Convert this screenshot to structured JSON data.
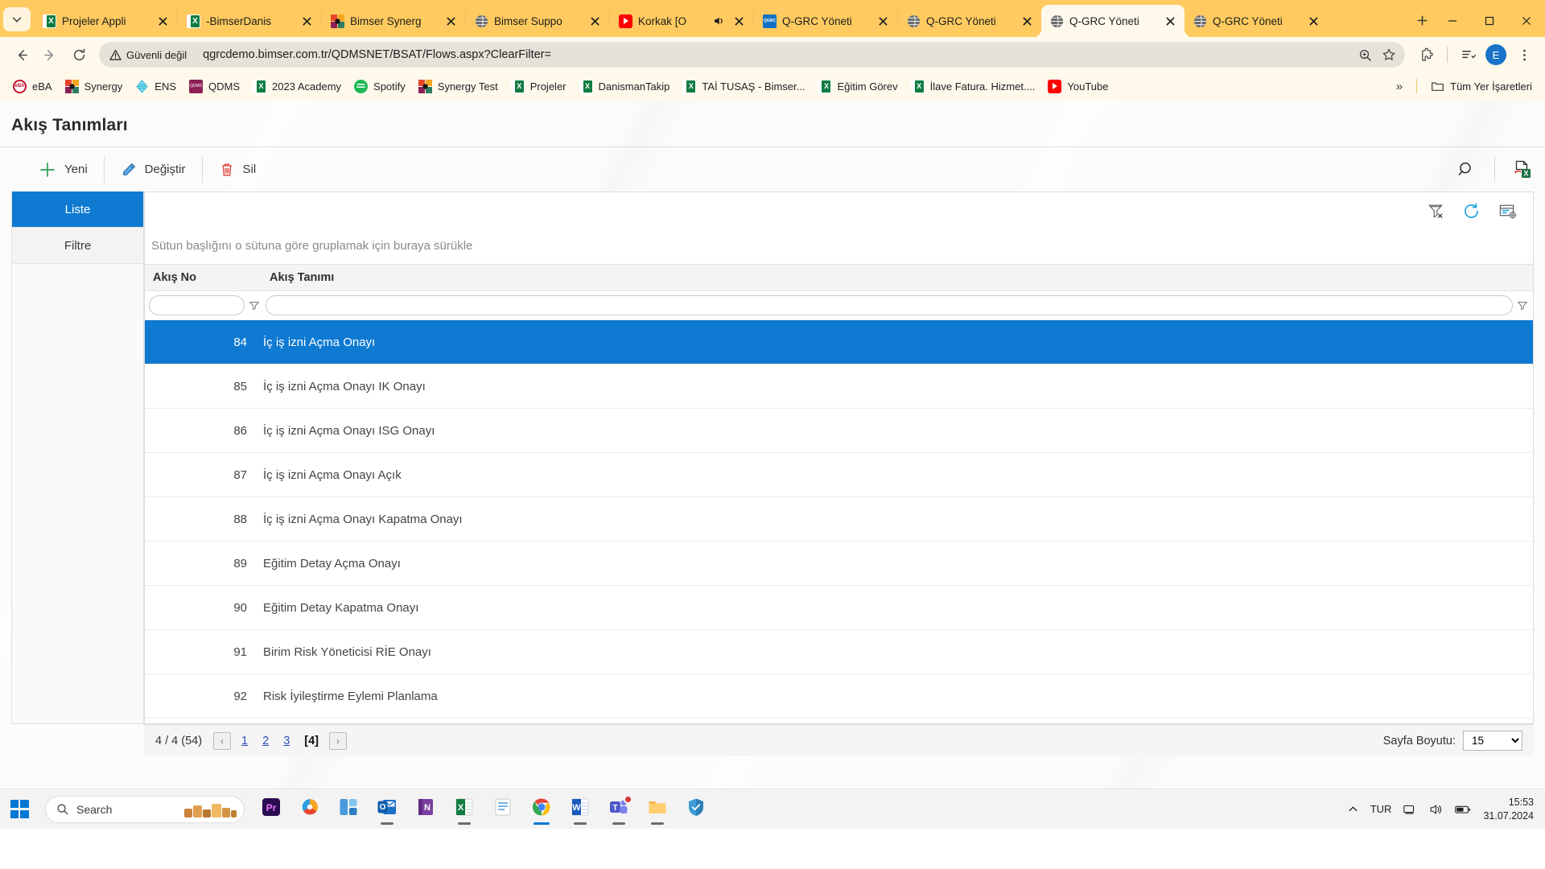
{
  "browser": {
    "tab_list_icon": "chevron-down-icon",
    "tabs": [
      {
        "title": "Projeler Appli",
        "favicon": "excel-icon",
        "active": false,
        "audio": false
      },
      {
        "title": "-BimserDanis",
        "favicon": "excel-icon",
        "active": false,
        "audio": false
      },
      {
        "title": "Bimser Synerg",
        "favicon": "bimser-icon",
        "active": false,
        "audio": false
      },
      {
        "title": "Bimser Suppo",
        "favicon": "globe-icon",
        "active": false,
        "audio": false
      },
      {
        "title": "Korkak [O",
        "favicon": "youtube-icon",
        "active": false,
        "audio": true
      },
      {
        "title": "Q-GRC Yöneti",
        "favicon": "qgrc-icon",
        "active": false,
        "audio": false
      },
      {
        "title": "Q-GRC Yöneti",
        "favicon": "globe-icon",
        "active": false,
        "audio": false
      },
      {
        "title": "Q-GRC Yöneti",
        "favicon": "globe-icon",
        "active": true,
        "audio": false
      },
      {
        "title": "Q-GRC Yöneti",
        "favicon": "globe-icon",
        "active": false,
        "audio": false
      }
    ],
    "new_tab_label": "+",
    "window_controls": {
      "minimize": "–",
      "maximize": "▢",
      "close": "✕"
    },
    "nav": {
      "back": "back-icon",
      "forward": "forward-icon",
      "reload": "reload-icon"
    },
    "omnibox": {
      "security_label": "Güvenli değil",
      "url": "qgrcdemo.bimser.com.tr/QDMSNET/BSAT/Flows.aspx?ClearFilter=",
      "zoom_icon": "zoom-in-icon",
      "bookmark_icon": "star-icon"
    },
    "toolbar_icons": {
      "extensions": "puzzle-icon",
      "reading_list": "reading-list-icon",
      "profile_initial": "E",
      "menu": "three-dot-menu-icon"
    },
    "bookmarks": [
      {
        "label": "eBA",
        "icon": "eba-icon"
      },
      {
        "label": "Synergy",
        "icon": "bimser-icon"
      },
      {
        "label": "ENS",
        "icon": "ens-icon"
      },
      {
        "label": "QDMS",
        "icon": "qdms-icon"
      },
      {
        "label": "2023 Academy",
        "icon": "excel-icon"
      },
      {
        "label": "Spotify",
        "icon": "spotify-icon"
      },
      {
        "label": "Synergy Test",
        "icon": "bimser-icon"
      },
      {
        "label": "Projeler",
        "icon": "excel-icon"
      },
      {
        "label": "DanismanTakip",
        "icon": "excel-icon"
      },
      {
        "label": "TAİ TUSAŞ - Bimser...",
        "icon": "excel-icon"
      },
      {
        "label": "Eğitim Görev",
        "icon": "excel-icon"
      },
      {
        "label": "İlave Fatura. Hizmet....",
        "icon": "excel-icon"
      },
      {
        "label": "YouTube",
        "icon": "youtube-icon"
      }
    ],
    "bookmarks_overflow": "»",
    "all_bookmarks_label": "Tüm Yer İşaretleri"
  },
  "app": {
    "page_title": "Akış Tanımları",
    "toolbar": [
      {
        "label": "Yeni",
        "icon": "plus-icon"
      },
      {
        "label": "Değiştir",
        "icon": "pencil-icon"
      },
      {
        "label": "Sil",
        "icon": "trash-icon"
      }
    ],
    "toolbar_right": [
      {
        "name": "search-icon"
      },
      {
        "name": "export-excel-icon"
      }
    ],
    "side_tabs": [
      {
        "label": "Liste",
        "active": true
      },
      {
        "label": "Filtre",
        "active": false
      }
    ],
    "grid_header_icons": [
      {
        "name": "clear-filter-icon"
      },
      {
        "name": "refresh-icon"
      },
      {
        "name": "grid-settings-icon"
      }
    ],
    "group_panel_text": "Sütun başlığını o sütuna göre gruplamak için buraya sürükle",
    "columns": [
      "Akış No",
      "Akış Tanımı"
    ],
    "filter_values": [
      "",
      ""
    ],
    "filter_icon": "filter-funnel-icon",
    "rows": [
      {
        "no": "84",
        "name": "İç iş izni Açma Onayı",
        "selected": true
      },
      {
        "no": "85",
        "name": "İç iş izni Açma Onayı IK Onayı",
        "selected": false
      },
      {
        "no": "86",
        "name": "İç iş izni Açma Onayı ISG Onayı",
        "selected": false
      },
      {
        "no": "87",
        "name": "İç iş izni Açma Onayı Açık",
        "selected": false
      },
      {
        "no": "88",
        "name": "İç iş izni Açma Onayı Kapatma Onayı",
        "selected": false
      },
      {
        "no": "89",
        "name": "Eğitim Detay Açma Onayı",
        "selected": false
      },
      {
        "no": "90",
        "name": "Eğitim Detay Kapatma Onayı",
        "selected": false
      },
      {
        "no": "91",
        "name": "Birim Risk Yöneticisi RİE Onayı",
        "selected": false
      },
      {
        "no": "92",
        "name": "Risk İyileştirme Eylemi Planlama",
        "selected": false
      }
    ],
    "footer": {
      "summary": "4 / 4 (54)",
      "prev_label": "‹",
      "next_label": "›",
      "pages": [
        "1",
        "2",
        "3"
      ],
      "current_page": "[4]",
      "page_size_label": "Sayfa Boyutu:",
      "page_size_value": "15"
    }
  },
  "taskbar": {
    "start_icon": "windows-start-icon",
    "search_placeholder": "Search",
    "apps": [
      {
        "name": "premiere-icon",
        "running": false,
        "badge": false
      },
      {
        "name": "photos-icon",
        "running": false,
        "badge": false
      },
      {
        "name": "widgets-icon",
        "running": false,
        "badge": false
      },
      {
        "name": "outlook-icon",
        "running": true,
        "badge": false
      },
      {
        "name": "onenote-icon",
        "running": false,
        "badge": false
      },
      {
        "name": "excel-icon",
        "running": true,
        "badge": false
      },
      {
        "name": "notepad-icon",
        "running": false,
        "badge": false
      },
      {
        "name": "chrome-icon",
        "running": true,
        "badge": false
      },
      {
        "name": "word-icon",
        "running": true,
        "badge": false
      },
      {
        "name": "teams-icon",
        "running": true,
        "badge": true
      },
      {
        "name": "file-explorer-icon",
        "running": true,
        "badge": false
      },
      {
        "name": "security-icon",
        "running": false,
        "badge": false
      }
    ],
    "tray": {
      "overflow_icon": "chevron-up-icon",
      "language": "TUR",
      "network_icon": "network-icon",
      "volume_icon": "volume-icon",
      "battery_icon": "battery-icon",
      "time": "15:53",
      "date": "31.07.2024"
    }
  }
}
